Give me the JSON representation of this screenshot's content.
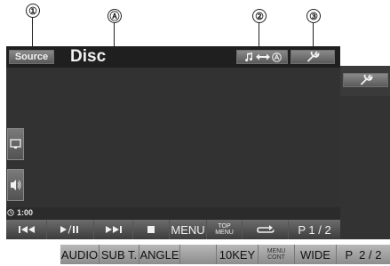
{
  "callouts": {
    "one": "①",
    "a": "Ⓐ",
    "two": "②",
    "three": "③"
  },
  "header": {
    "source_label": "Source",
    "title": "Disc"
  },
  "status": {
    "time": "1:00"
  },
  "controls": {
    "menu": "MENU",
    "top_menu_line1": "TOP",
    "top_menu_line2": "MENU",
    "page": "P 1 / 2"
  },
  "bottom": {
    "audio": "AUDIO",
    "subtitle": "SUB T.",
    "angle": "ANGLE",
    "tenkey": "10KEY",
    "menu_cont_line1": "MENU",
    "menu_cont_line2": "CONT",
    "wide": "WIDE",
    "page": "P  2 / 2"
  },
  "icons": [
    "music-icon",
    "switch-arrow-icon",
    "a-circle-icon",
    "wrench-icon",
    "monitor-icon",
    "speaker-icon",
    "clock-icon",
    "previous-icon",
    "play-pause-icon",
    "next-icon",
    "stop-icon",
    "repeat-icon"
  ]
}
